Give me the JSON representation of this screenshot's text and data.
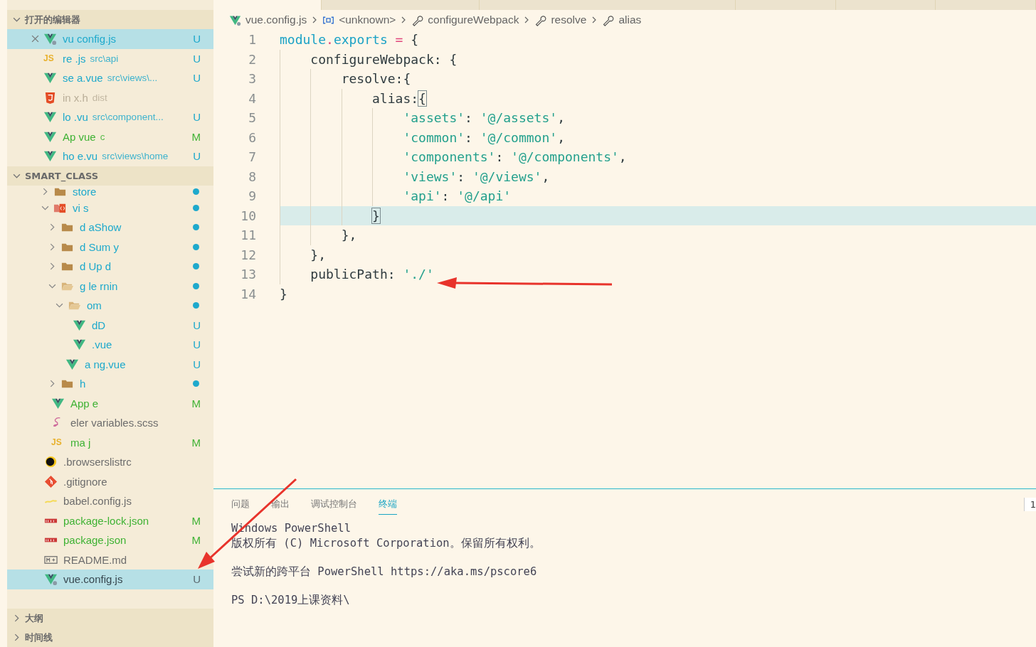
{
  "sidebar": {
    "open_editors": {
      "title": "打开的编辑器",
      "expanded": true,
      "items": [
        {
          "name": "vu",
          "extra": "config.js",
          "kind": "vue-config",
          "color": "#1ea9cc",
          "status": "U",
          "selected": true,
          "close": true
        },
        {
          "name": "re",
          "extra": ".js",
          "path": "src\\api",
          "kind": "js",
          "icon_text": "JS",
          "color": "#1ea9cc",
          "status": "U",
          "selected": false,
          "close": false
        },
        {
          "name": "se",
          "extra": "a.vue",
          "path": "src\\views\\...",
          "kind": "vue",
          "color": "#1ea9cc",
          "status": "U",
          "selected": false,
          "close": false
        },
        {
          "name": "in",
          "extra": "x.h",
          "path": "dist",
          "kind": "html",
          "color": "#b9ae98",
          "selected": false,
          "close": false
        },
        {
          "name": "lo",
          "extra": ".vu",
          "path": "src\\component...",
          "kind": "vue",
          "color": "#1ea9cc",
          "status": "U",
          "selected": false,
          "close": false
        },
        {
          "name": "Ap",
          "extra": "vue",
          "path": "c",
          "kind": "vue",
          "color": "#3fb234",
          "status": "M",
          "selected": false,
          "close": false
        },
        {
          "name": "ho",
          "extra": "e.vu",
          "path": "src\\views\\home",
          "kind": "vue",
          "color": "#1ea9cc",
          "status": "U",
          "selected": false,
          "close": false
        }
      ]
    },
    "project": {
      "title": "SMART_CLASS",
      "expanded": true,
      "nested_items": [
        {
          "name": "store",
          "kind": "folder",
          "color": "#1ea9cc",
          "expanded": false,
          "selected": false
        },
        {
          "name": "vi s",
          "kind": "views-folder",
          "color": "#1ea9cc",
          "expanded": true,
          "selected": false,
          "children": [
            {
              "name": "d aShow",
              "kind": "folder",
              "color": "#1ea9cc",
              "expanded": false,
              "selected": false
            },
            {
              "name": "d Sum y",
              "kind": "folder",
              "color": "#1ea9cc",
              "expanded": false,
              "selected": false
            },
            {
              "name": "d Up d",
              "kind": "folder",
              "color": "#1ea9cc",
              "expanded": false,
              "selected": false
            },
            {
              "name": "g le rnin",
              "kind": "folder",
              "color": "#1ea9cc",
              "expanded": true,
              "selected": false,
              "children": [
                {
                  "name": "om",
                  "kind": "folder",
                  "color": "#1ea9cc",
                  "expanded": true,
                  "selected": false,
                  "children": [
                    {
                      "name": "dD",
                      "kind": "vue",
                      "color": "#1ea9cc",
                      "status": "U",
                      "selected": false
                    },
                    {
                      "name": ".vue",
                      "kind": "vue",
                      "color": "#1ea9cc",
                      "status": "U",
                      "selected": false
                    }
                  ]
                },
                {
                  "name": "a ng.vue",
                  "kind": "vue",
                  "color": "#1ea9cc",
                  "status": "U",
                  "selected": false
                }
              ]
            },
            {
              "name": "h",
              "kind": "folder",
              "color": "#1ea9cc",
              "expanded": false,
              "selected": false
            }
          ]
        },
        {
          "name": "App e",
          "kind": "vue",
          "color": "#3fb234",
          "status": "M",
          "selected": false
        },
        {
          "name": "eler variables.scss",
          "kind": "sass",
          "selected": false
        },
        {
          "name": "ma j",
          "kind": "js",
          "icon_text": "JS",
          "color": "#3fb234",
          "status": "M",
          "selected": false
        }
      ],
      "root_items": [
        {
          "name": ".browserslistrc",
          "kind": "browserslist",
          "selected": false
        },
        {
          "name": ".gitignore",
          "kind": "git",
          "selected": false
        },
        {
          "name": "babel.config.js",
          "kind": "babel",
          "selected": false
        },
        {
          "name": "package-lock.json",
          "kind": "npm",
          "color": "#3fb234",
          "status": "M",
          "selected": false
        },
        {
          "name": "package.json",
          "kind": "npm",
          "color": "#3fb234",
          "status": "M",
          "selected": false
        },
        {
          "name": "README.md",
          "kind": "markdown",
          "selected": false
        },
        {
          "name": "vue.config.js",
          "kind": "vue-config",
          "status": "U",
          "selected": true
        }
      ]
    },
    "bottom_sections": [
      {
        "title": "大纲",
        "expanded": false
      },
      {
        "title": "时间线",
        "expanded": false
      }
    ]
  },
  "editor": {
    "tabs": [
      {
        "selected": true
      },
      {
        "selected": false
      },
      {
        "selected": false
      },
      {
        "selected": false
      },
      {
        "selected": false
      },
      {
        "selected": false
      }
    ],
    "breadcrumbs": [
      {
        "label": "vue.config.js",
        "kind": "vue-config"
      },
      {
        "label": "<unknown>",
        "kind": "symbol"
      },
      {
        "label": "configureWebpack",
        "kind": "wrench"
      },
      {
        "label": "resolve",
        "kind": "wrench"
      },
      {
        "label": "alias",
        "kind": "wrench"
      }
    ],
    "lines": [
      {
        "number": "1",
        "current": false,
        "tokens": [
          {
            "t": "module",
            "kind": "ident"
          },
          {
            "t": ".",
            "kind": "op"
          },
          {
            "t": "exports",
            "kind": "ident"
          },
          {
            "t": " = ",
            "kind": "op"
          },
          {
            "t": "{",
            "kind": "plain"
          }
        ]
      },
      {
        "number": "2",
        "current": false,
        "tokens": [
          {
            "t": "    configureWebpack: {",
            "kind": "plain"
          }
        ]
      },
      {
        "number": "3",
        "current": false,
        "tokens": [
          {
            "t": "        resolve:{",
            "kind": "plain"
          }
        ]
      },
      {
        "number": "4",
        "current": false,
        "tokens": [
          {
            "t": "            alias:",
            "kind": "plain"
          },
          {
            "t": "{",
            "kind": "match"
          }
        ]
      },
      {
        "number": "5",
        "current": false,
        "tokens": [
          {
            "t": "                'assets'",
            "kind": "string"
          },
          {
            "t": ": ",
            "kind": "plain"
          },
          {
            "t": "'@/assets'",
            "kind": "string"
          },
          {
            "t": ",",
            "kind": "plain"
          }
        ]
      },
      {
        "number": "6",
        "current": false,
        "tokens": [
          {
            "t": "                'common'",
            "kind": "string"
          },
          {
            "t": ": ",
            "kind": "plain"
          },
          {
            "t": "'@/common'",
            "kind": "string"
          },
          {
            "t": ",",
            "kind": "plain"
          }
        ]
      },
      {
        "number": "7",
        "current": false,
        "tokens": [
          {
            "t": "                'components'",
            "kind": "string"
          },
          {
            "t": ": ",
            "kind": "plain"
          },
          {
            "t": "'@/components'",
            "kind": "string"
          },
          {
            "t": ",",
            "kind": "plain"
          }
        ]
      },
      {
        "number": "8",
        "current": false,
        "tokens": [
          {
            "t": "                'views'",
            "kind": "string"
          },
          {
            "t": ": ",
            "kind": "plain"
          },
          {
            "t": "'@/views'",
            "kind": "string"
          },
          {
            "t": ",",
            "kind": "plain"
          }
        ]
      },
      {
        "number": "9",
        "current": false,
        "tokens": [
          {
            "t": "                'api'",
            "kind": "string"
          },
          {
            "t": ": ",
            "kind": "plain"
          },
          {
            "t": "'@/api'",
            "kind": "string"
          }
        ]
      },
      {
        "number": "10",
        "current": true,
        "tokens": [
          {
            "t": "            }",
            "kind": "match"
          }
        ]
      },
      {
        "number": "11",
        "current": false,
        "tokens": [
          {
            "t": "        },",
            "kind": "plain"
          }
        ]
      },
      {
        "number": "12",
        "current": false,
        "tokens": [
          {
            "t": "    },",
            "kind": "plain"
          }
        ]
      },
      {
        "number": "13",
        "current": false,
        "tokens": [
          {
            "t": "    publicPath: ",
            "kind": "plain"
          },
          {
            "t": "'./'",
            "kind": "string"
          }
        ]
      },
      {
        "number": "14",
        "current": false,
        "tokens": [
          {
            "t": "}",
            "kind": "plain"
          }
        ]
      }
    ]
  },
  "panel": {
    "tabs": [
      {
        "label": "问题",
        "selected": false
      },
      {
        "label": "输出",
        "selected": false
      },
      {
        "label": "调试控制台",
        "selected": false
      },
      {
        "label": "终端",
        "selected": true
      }
    ],
    "terminal_selector": "1",
    "terminal_blocks": [
      [
        "Windows PowerShell",
        "版权所有 (C) Microsoft Corporation。保留所有权利。"
      ],
      [
        "尝试新的跨平台 PowerShell https://aka.ms/pscore6"
      ],
      [
        "PS D:\\2019上课资料\\"
      ]
    ]
  },
  "annotations": [
    {
      "kind": "arrow"
    },
    {
      "kind": "arrow"
    }
  ]
}
